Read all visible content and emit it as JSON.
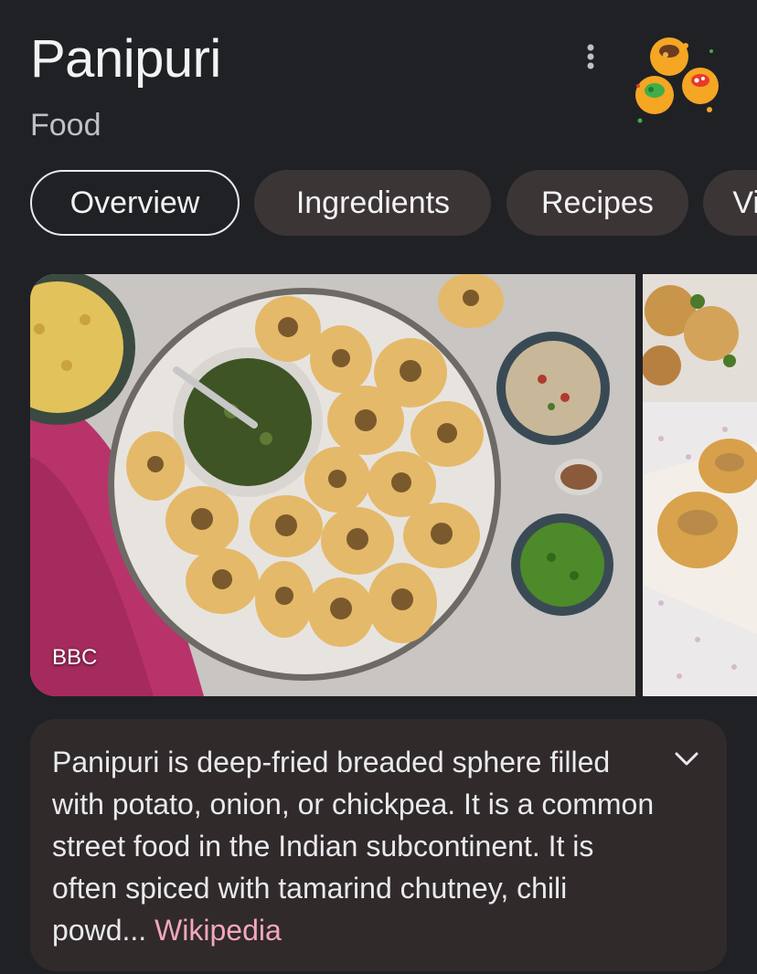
{
  "header": {
    "title": "Panipuri",
    "subtitle": "Food"
  },
  "header_icons": {
    "menu": "more-vert-icon",
    "entity": "panipuri-food-icon"
  },
  "tabs": [
    {
      "label": "Overview",
      "active": true
    },
    {
      "label": "Ingredients",
      "active": false
    },
    {
      "label": "Recipes",
      "active": false
    },
    {
      "label": "Vi",
      "active": false
    }
  ],
  "media": {
    "main_credit": "BBC"
  },
  "description": {
    "text": "Panipuri is deep-fried breaded sphere filled with potato, onion, or chickpea. It is a common street food in the Indian subcontinent. It is often spiced with tamarind chutney, chili powd",
    "ellipsis": "...",
    "source_link": "Wikipedia",
    "expand_icon": "chevron-down-icon"
  },
  "colors": {
    "background": "#202124",
    "chip_background": "#3c3536",
    "card_background": "#302a2b",
    "link": "#f4a7bd"
  }
}
